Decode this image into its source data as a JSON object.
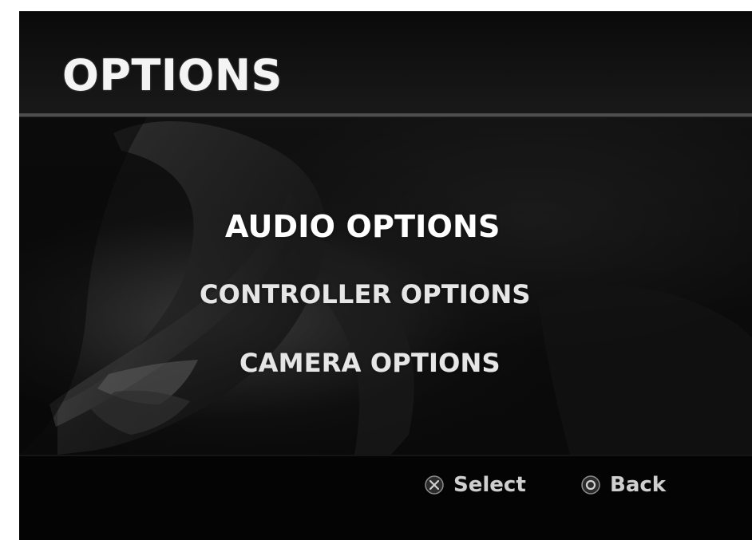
{
  "screen": {
    "title": "OPTIONS",
    "menu_items": [
      {
        "label": "AUDIO OPTIONS",
        "selected": true
      },
      {
        "label": "CONTROLLER OPTIONS",
        "selected": false
      },
      {
        "label": "CAMERA OPTIONS",
        "selected": false
      }
    ],
    "hints": [
      {
        "icon": "cross-button-icon",
        "label": "Select"
      },
      {
        "icon": "circle-button-icon",
        "label": "Back"
      }
    ],
    "colors": {
      "background": "#070707",
      "text_primary": "#ffffff",
      "text_secondary": "#e6e6e6",
      "hint_text": "#cfcfcf"
    }
  }
}
